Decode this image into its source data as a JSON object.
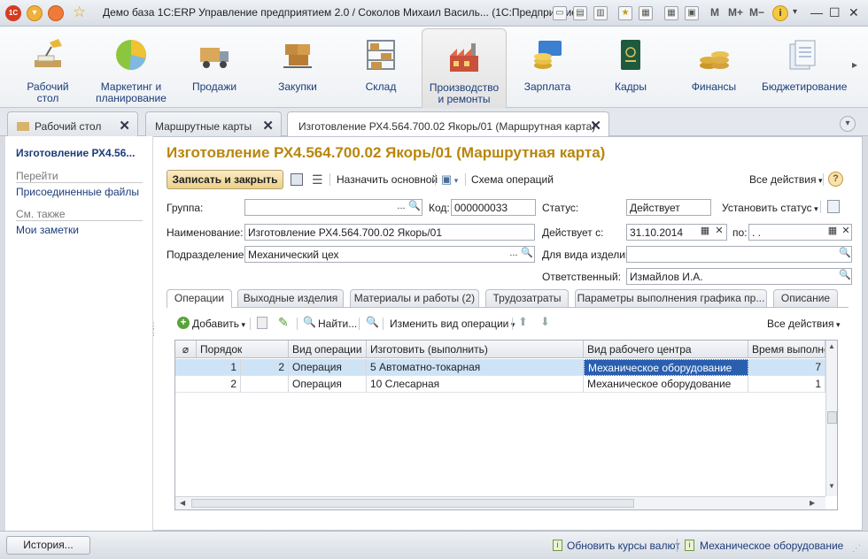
{
  "titlebar": {
    "title": "Демо база 1С:ERP Управление предприятием 2.0 / Соколов Михаил Василь... (1С:Предприятие)",
    "m": "M",
    "mplus": "M+",
    "mminus": "M−",
    "info": "i",
    "min": "—",
    "max": "☐",
    "close": "✕"
  },
  "sections": [
    {
      "label": "Рабочий\nстол",
      "icon": "desk-lamp-icon"
    },
    {
      "label": "Маркетинг и\nпланирование",
      "icon": "pie-chart-icon"
    },
    {
      "label": "Продажи",
      "icon": "truck-icon"
    },
    {
      "label": "Закупки",
      "icon": "cart-boxes-icon"
    },
    {
      "label": "Склад",
      "icon": "warehouse-shelf-icon"
    },
    {
      "label": "Производство\nи ремонты",
      "icon": "factory-icon"
    },
    {
      "label": "Зарплата",
      "icon": "money-card-icon"
    },
    {
      "label": "Кадры",
      "icon": "passport-icon"
    },
    {
      "label": "Финансы",
      "icon": "coins-icon"
    },
    {
      "label": "Бюджетирование",
      "icon": "documents-icon"
    }
  ],
  "open_tabs": [
    "Рабочий стол",
    "Маршрутные карты",
    "Изготовление РХ4.564.700.02 Якорь/01 (Маршрутная карта)"
  ],
  "leftnav": {
    "title": "Изготовление РХ4.56...",
    "go_header": "Перейти",
    "go_items": [
      "Присоединенные файлы"
    ],
    "see_header": "См. также",
    "see_items": [
      "Мои заметки"
    ]
  },
  "form": {
    "title": "Изготовление РХ4.564.700.02 Якорь/01 (Маршрутная карта)",
    "toolbar": {
      "save_close": "Записать и закрыть",
      "set_main": "Назначить основной",
      "scheme": "Схема операций",
      "all_actions": "Все действия",
      "help": "?"
    },
    "labels": {
      "group": "Группа:",
      "code": "Код:",
      "status": "Статус:",
      "set_status": "Установить статус",
      "name": "Наименование:",
      "valid_from": "Действует с:",
      "to": "по:",
      "dept": "Подразделение:",
      "for_type": "Для вида изделий:",
      "responsible": "Ответственный:"
    },
    "values": {
      "group": "",
      "code": "000000033",
      "status": "Действует",
      "name": "Изготовление РХ4.564.700.02 Якорь/01",
      "valid_from": "31.10.2014",
      "valid_to": " .  .",
      "dept": "Механический цех",
      "for_type": "",
      "responsible": "Измайлов И.А."
    },
    "tabs": [
      "Операции",
      "Выходные изделия",
      "Материалы и работы (2)",
      "Трудозатраты",
      "Параметры выполнения графика пр...",
      "Описание"
    ],
    "grid_toolbar": {
      "add": "Добавить",
      "find": "Найти...",
      "change_type": "Изменить вид операции",
      "all_actions": "Все действия"
    },
    "grid": {
      "columns": [
        "",
        "Порядок",
        "Вид операции",
        "Изготовить (выполнить)",
        "Вид рабочего центра",
        "Время выполнен"
      ],
      "rows": [
        {
          "order": "1",
          "order2": "2",
          "op": "Операция",
          "make": "5 Автоматно-токарная",
          "center": "Механическое оборудование",
          "time": "7"
        },
        {
          "order": "2",
          "order2": "",
          "op": "Операция",
          "make": "10 Слесарная",
          "center": "Механическое оборудование",
          "time": "1"
        }
      ]
    }
  },
  "statusbar": {
    "history": "История...",
    "update_rates": "Обновить курсы валют",
    "equipment": "Механическое оборудование"
  },
  "colors": {
    "title": "#b8860b",
    "link": "#1c3c7a",
    "selected_row": "#cfe3f7",
    "active_cell": "#2a5fb0"
  }
}
